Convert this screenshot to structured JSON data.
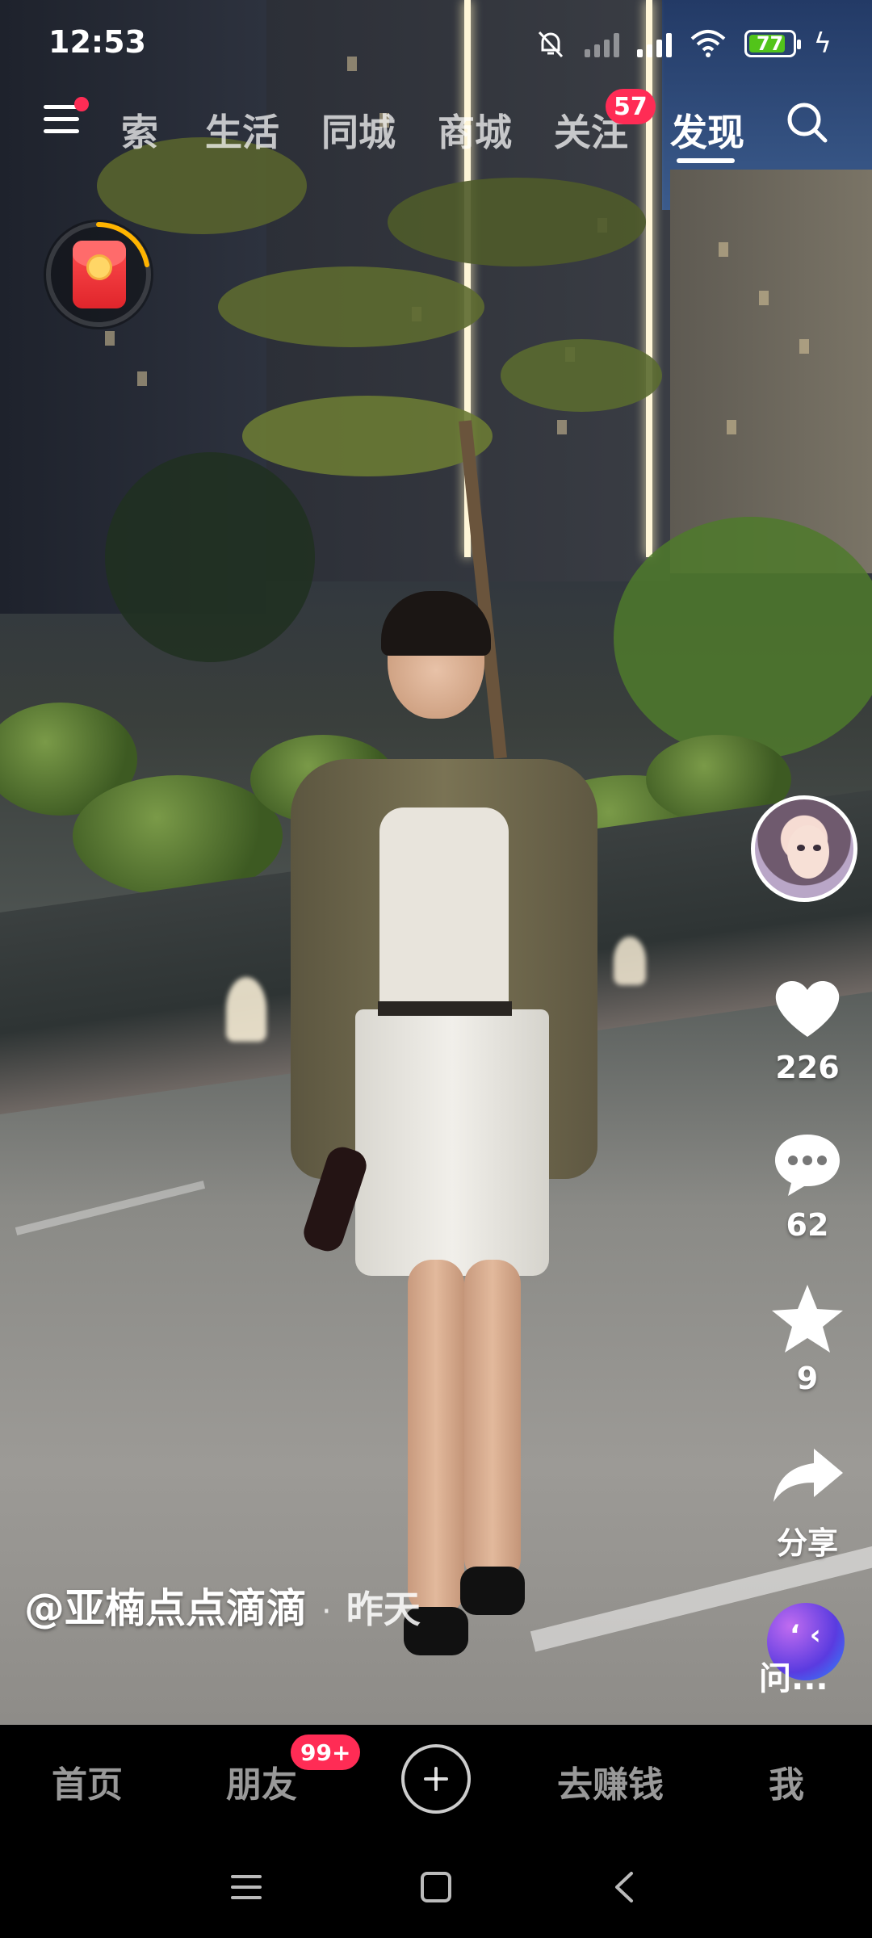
{
  "status_bar": {
    "time": "12:53",
    "battery_level": "77",
    "icons": [
      "mute-bell-icon",
      "no-signal-icon",
      "signal-icon",
      "wifi-icon",
      "battery-icon",
      "charging-icon"
    ]
  },
  "top_tabs": {
    "items": [
      {
        "label": "索"
      },
      {
        "label": "生活"
      },
      {
        "label": "同城"
      },
      {
        "label": "商城"
      },
      {
        "label": "关注"
      },
      {
        "label": "发现"
      }
    ],
    "active": "发现",
    "follow_badge": "57"
  },
  "actions": {
    "like_count": "226",
    "comment_count": "62",
    "favorite_count": "9",
    "share_label": "分享",
    "ask_label": "问..."
  },
  "caption": {
    "author": "@亚楠点点滴滴",
    "separator": "·",
    "posted": "昨天"
  },
  "bottom_nav": {
    "home": "首页",
    "friends": "朋友",
    "friends_badge": "99+",
    "earn": "去赚钱",
    "me": "我"
  },
  "colors": {
    "accent_red": "#ff2c55",
    "battery_green": "#52c41a"
  }
}
